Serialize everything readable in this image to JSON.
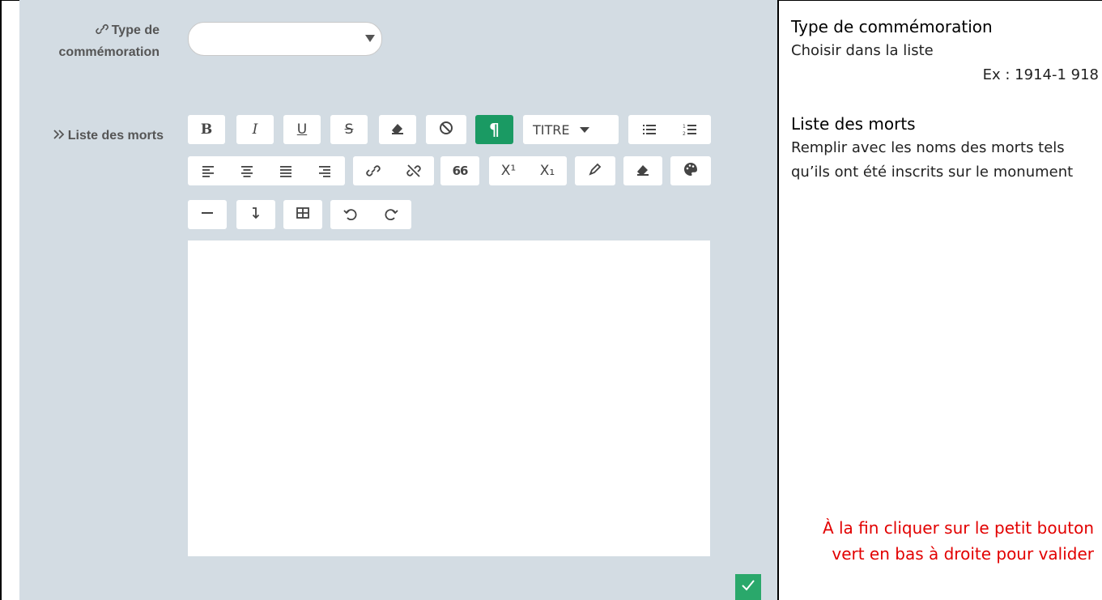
{
  "form": {
    "type_label_line1": "Type de",
    "type_label_line2": "commémoration",
    "type_value": "",
    "liste_label": "Liste des morts",
    "editor_content": ""
  },
  "toolbar": {
    "bold": "B",
    "italic": "I",
    "underline": "U",
    "strike": "S",
    "style_dropdown": "TITRE",
    "superscript": "X¹",
    "subscript": "X₁",
    "active_color": "#1a9a63"
  },
  "help": {
    "type_title": "Type de commémoration",
    "type_desc": "Choisir dans la liste",
    "type_example": "Ex : 1914-1 918",
    "liste_title": "Liste des morts",
    "liste_desc": "Remplir avec les noms des morts tels qu’ils ont été inscrits sur le monument",
    "final_note": "À la fin cliquer sur le petit bouton vert en bas à droite pour valider",
    "note_color": "#e20000"
  }
}
